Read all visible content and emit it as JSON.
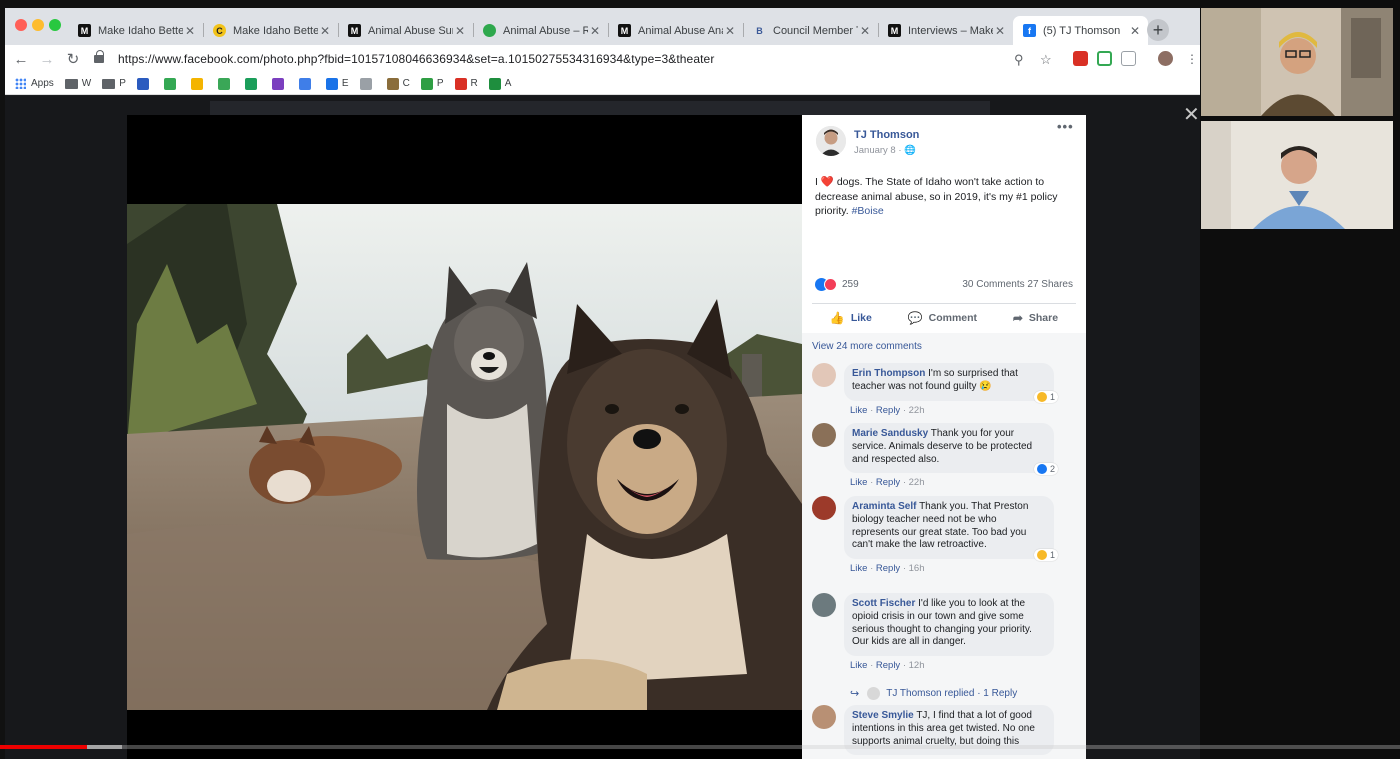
{
  "browser": {
    "tabs": [
      {
        "title": "Make Idaho Better",
        "icon": "medium-icon",
        "fav": "M",
        "fav_bg": "#111111",
        "fav_fg": "#ffffff"
      },
      {
        "title": "Make Idaho Better",
        "icon": "make-idaho-icon",
        "fav": "C",
        "fav_bg": "#f2c31a",
        "fav_fg": "#222222"
      },
      {
        "title": "Animal Abuse Sur",
        "icon": "medium-icon",
        "fav": "M",
        "fav_bg": "#111111",
        "fav_fg": "#ffffff"
      },
      {
        "title": "Animal Abuse – Re",
        "icon": "green-circle-icon",
        "fav": "",
        "fav_bg": "#2ea84d",
        "fav_fg": "#ffffff"
      },
      {
        "title": "Animal Abuse Ana",
        "icon": "medium-icon",
        "fav": "M",
        "fav_bg": "#111111",
        "fav_fg": "#ffffff"
      },
      {
        "title": "Council Member T",
        "icon": "b-icon",
        "fav": "B",
        "fav_bg": "#dee1e6",
        "fav_fg": "#3b5998"
      },
      {
        "title": "Interviews – Make",
        "icon": "medium-icon",
        "fav": "M",
        "fav_bg": "#111111",
        "fav_fg": "#ffffff"
      },
      {
        "title": "(5) TJ Thomson",
        "icon": "facebook-icon",
        "fav": "f",
        "fav_bg": "#1877f2",
        "fav_fg": "#ffffff",
        "active": true
      }
    ],
    "url": "https://www.facebook.com/photo.php?fbid=10157108046636934&set=a.10150275534316934&type=3&theater",
    "bookmarks": [
      {
        "label": "Apps",
        "icon": "apps-grid-icon"
      },
      {
        "label": "W",
        "icon": "folder-icon"
      },
      {
        "label": "P",
        "icon": "folder-icon"
      }
    ],
    "bookmark_icons": [
      {
        "icon": "k-icon",
        "color": "#2b5bbf"
      },
      {
        "icon": "drive-icon",
        "color": "#34a853"
      },
      {
        "icon": "pinwheel-icon",
        "color": "#f4b400"
      },
      {
        "icon": "cloud-icon",
        "color": "#3aa757"
      },
      {
        "icon": "ring-icon",
        "color": "#1b9e5a"
      },
      {
        "icon": "a-icon",
        "color": "#7b3fbf"
      },
      {
        "icon": "c-icon",
        "color": "#3f7ee8"
      },
      {
        "icon": "chat-icon",
        "color": "#1a73e8"
      },
      {
        "icon": "doc-icon",
        "color": "#9aa0a6"
      },
      {
        "icon": "k2-icon",
        "color": "#8a6d3b"
      },
      {
        "icon": "leaf-icon",
        "color": "#2f9e44"
      },
      {
        "icon": "tag-icon",
        "color": "#d93025"
      },
      {
        "icon": "sheet-icon",
        "color": "#1e8e3e"
      }
    ],
    "bookmark_letters": [
      "E",
      "C",
      "P",
      "R",
      "A"
    ]
  },
  "post": {
    "author": "TJ Thomson",
    "date": "January 8 · ",
    "text_before_heart": "I ",
    "text_after_heart": " dogs. The State of Idaho won't take action to decrease animal abuse, so in 2019, it's my #1 policy priority. ",
    "hashtag": "#Boise",
    "reaction_count": "259",
    "comment_share": "30 Comments  27 Shares",
    "actions": {
      "like": "Like",
      "comment": "Comment",
      "share": "Share"
    },
    "view_more": "View 24 more comments"
  },
  "comments": [
    {
      "name": "Erin Thompson",
      "text": "I'm so surprised that teacher was not found guilty 😢",
      "meta_like": "Like",
      "meta_reply": "Reply",
      "time": "22h",
      "react_count": "1",
      "react_color": "#f7b928"
    },
    {
      "name": "Marie Sandusky",
      "text": "Thank you for your service. Animals deserve to be protected and respected also.",
      "meta_like": "Like",
      "meta_reply": "Reply",
      "time": "22h",
      "react_count": "2",
      "react_color": "#1877f2"
    },
    {
      "name": "Araminta Self",
      "text": "Thank you. That Preston biology teacher need not be who represents our great state. Too bad you can't make the law retroactive.",
      "meta_like": "Like",
      "meta_reply": "Reply",
      "time": "16h",
      "react_count": "1",
      "react_color": "#f7b928"
    },
    {
      "name": "Scott Fischer",
      "text": "I'd like you to look at the opioid crisis in our town and give some serious thought to changing your priority. Our kids are all in danger.",
      "meta_like": "Like",
      "meta_reply": "Reply",
      "time": "12h",
      "react_count": "",
      "react_color": ""
    },
    {
      "name": "Steve Smylie",
      "text": "TJ, I find that a lot of good intentions in this area get twisted. No one supports animal cruelty, but doing this",
      "meta_like": "",
      "meta_reply": "",
      "time": "",
      "react_count": "",
      "react_color": ""
    }
  ],
  "reply": {
    "name": "TJ Thomson replied",
    "count": "· 1 Reply"
  },
  "video": {
    "progress_fraction": 0.062,
    "buffered_fraction": 0.087
  },
  "colors": {
    "facebook_blue": "#385898",
    "like_blue": "#1877f2",
    "love_red": "#f33e58",
    "progress_red": "#ee0000"
  }
}
